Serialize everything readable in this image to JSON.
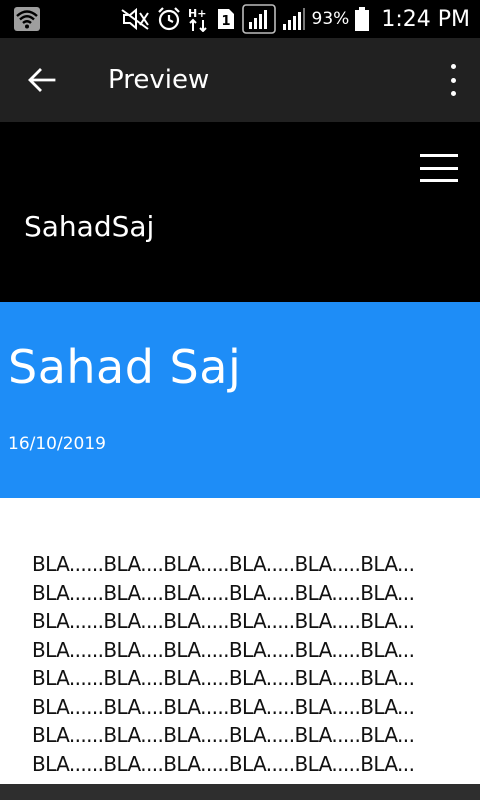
{
  "status_bar": {
    "battery_percent": "93%",
    "time": "1:24 PM",
    "sim_slot": "1",
    "icons": [
      "wifi-icon",
      "mute-icon",
      "alarm-icon",
      "data-transfer-icon",
      "sim-icon",
      "signal-icon",
      "signal-icon-2",
      "battery-icon"
    ]
  },
  "app_bar": {
    "title": "Preview",
    "back_icon": "arrow-back-icon",
    "menu_icon": "more-vert-icon"
  },
  "site_header": {
    "site_title": "SahadSaj",
    "menu_icon": "hamburger-icon"
  },
  "hero": {
    "post_title": "Sahad Saj",
    "post_date": "16/10/2019",
    "background_color": "#1e8df7"
  },
  "content": {
    "lines": [
      "BLA......BLA....BLA.....BLA.....BLA.....BLA...",
      "BLA......BLA....BLA.....BLA.....BLA.....BLA...",
      "BLA......BLA....BLA.....BLA.....BLA.....BLA...",
      "BLA......BLA....BLA.....BLA.....BLA.....BLA...",
      "BLA......BLA....BLA.....BLA.....BLA.....BLA...",
      "BLA......BLA....BLA.....BLA.....BLA.....BLA...",
      "BLA......BLA....BLA.....BLA.....BLA.....BLA...",
      "BLA......BLA....BLA.....BLA.....BLA.....BLA..."
    ]
  }
}
